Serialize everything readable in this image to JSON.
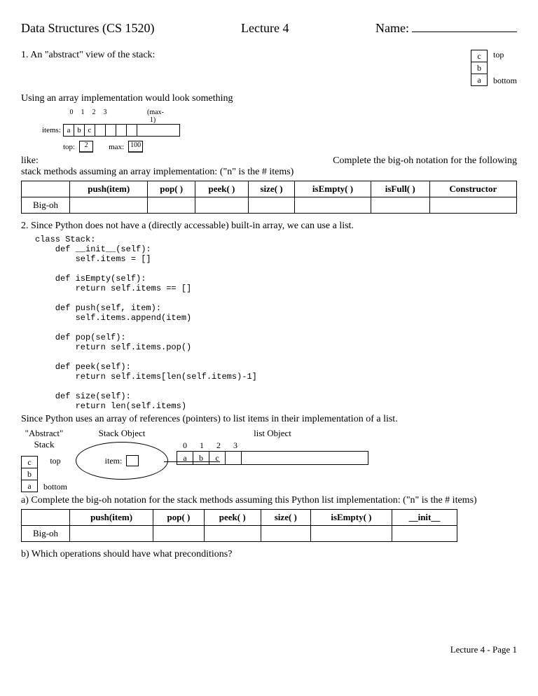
{
  "header": {
    "course": "Data Structures (CS 1520)",
    "lecture": "Lecture 4",
    "name_label": "Name:"
  },
  "q1": {
    "prompt": "1.  An \"abstract\" view of the stack:",
    "stack": {
      "top": "c",
      "mid": "b",
      "bot": "a",
      "top_label": "top",
      "bot_label": "bottom"
    }
  },
  "array_intro": "Using an array implementation would look something",
  "array": {
    "items_label": "items:",
    "indices": [
      "0",
      "1",
      "2",
      "3"
    ],
    "max_label": "(max-1)",
    "cells": [
      "a",
      "b",
      "c",
      "",
      "",
      "",
      ""
    ],
    "top_label": "top:",
    "top_val": "2",
    "max_lab2": "max:",
    "max_val": "100"
  },
  "like": "like:",
  "complete_text": "Complete the big-oh notation for the following",
  "stack_methods_line": "stack methods assuming an array implementation: (\"n\" is the # items)",
  "table1": {
    "headers": [
      "",
      "push(item)",
      "pop( )",
      "peek( )",
      "size( )",
      "isEmpty( )",
      "isFull( )",
      "Constructor"
    ],
    "row_label": "Big-oh"
  },
  "q2_intro": "2.  Since Python does not have a (directly accessable) built-in array, we can use a list.",
  "code": "class Stack:\n    def __init__(self):\n        self.items = []\n\n    def isEmpty(self):\n        return self.items == []\n\n    def push(self, item):\n        self.items.append(item)\n\n    def pop(self):\n        return self.items.pop()\n\n    def peek(self):\n        return self.items[len(self.items)-1]\n\n    def size(self):\n        return len(self.items)",
  "since_line": "Since Python uses an array of references (pointers) to list items in their implementation of a list.",
  "obj": {
    "abstract_label": "\"Abstract\"",
    "stack_label": "Stack",
    "stackobj_label": "Stack Object",
    "item_label": "item:",
    "listobj_label": "list Object",
    "list_indices": [
      "0",
      "1",
      "2",
      "3"
    ],
    "list_cells": [
      "a",
      "b",
      "c"
    ]
  },
  "q2a": "a) Complete the big-oh notation for the stack methods assuming this Python list implementation:  (\"n\" is the # items)",
  "table2": {
    "headers": [
      "",
      "push(item)",
      "pop( )",
      "peek( )",
      "size( )",
      "isEmpty( )",
      "__init__"
    ],
    "row_label": "Big-oh"
  },
  "q2b": "b)  Which operations should have what preconditions?",
  "footer": "Lecture 4 -  Page 1"
}
